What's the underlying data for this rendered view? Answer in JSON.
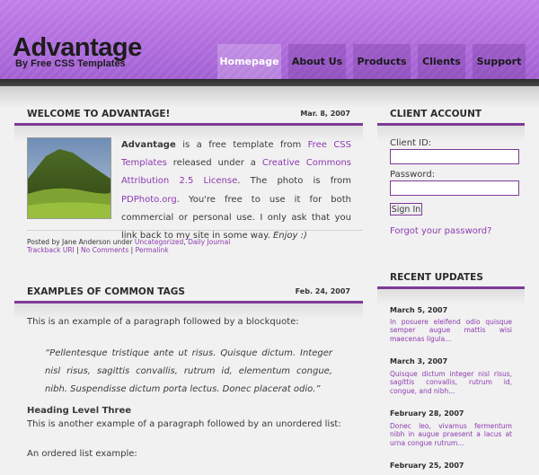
{
  "header": {
    "site_title": "Advantage",
    "site_subtitle": "By Free CSS Templates",
    "nav": [
      {
        "label": "Homepage"
      },
      {
        "label": "About Us"
      },
      {
        "label": "Products"
      },
      {
        "label": "Clients"
      },
      {
        "label": "Support"
      }
    ],
    "active_nav": "Homepage"
  },
  "colors": {
    "header_purple": "#b276de",
    "accent": "#7e3a98",
    "link": "#8d3ab0"
  },
  "post1": {
    "title": "WELCOME TO ADVANTAGE!",
    "date": "Mar. 8, 2007",
    "image_icon": "mountain-landscape-photo",
    "body": {
      "strong": "Advantage",
      "t1": " is a free template from ",
      "link1": "Free CSS Templates",
      "t2": " released under a ",
      "link2": "Creative Commons Attribution 2.5 License",
      "t3": ". The photo is from ",
      "link3": "PDPhoto.org",
      "t4": ". You're free to use it for both commercial or personal use. I only ask that you link back to my site in some way. ",
      "em": "Enjoy :)"
    },
    "meta": {
      "posted_by": "Posted by Jane Anderson under ",
      "cat1": "Uncategorized",
      "sep1": ", ",
      "cat2": "Daily Journal",
      "trackback": "Trackback URI",
      "sep2": " | ",
      "comments": "No Comments",
      "sep3": " | ",
      "permalink": "Permalink"
    }
  },
  "post2": {
    "title": "EXAMPLES OF COMMON TAGS",
    "date": "Feb. 24, 2007",
    "intro": "This is an example of a paragraph followed by a blockquote:",
    "quote": "“Pellentesque tristique ante ut risus. Quisque dictum. Integer nisl risus, sagittis convallis, rutrum id, elementum congue, nibh. Suspendisse dictum porta lectus. Donec placerat odio.”",
    "heading": "Heading Level Three",
    "para2": "This is another example of a paragraph followed by an unordered list:",
    "ordered_label": "An ordered list example:"
  },
  "sidebar": {
    "account_title": "CLIENT ACCOUNT",
    "client_id_label": "Client ID:",
    "client_id_value": "",
    "password_label": "Password:",
    "password_value": "",
    "signin_label": "Sign In",
    "forgot_label": "Forgot your password?",
    "updates_title": "RECENT UPDATES",
    "updates": [
      {
        "date": "March 5, 2007",
        "text": "In posuere eleifend odio quisque semper augue mattis wisi maecenas ligula..."
      },
      {
        "date": "March 3, 2007",
        "text": "Quisque dictum integer nisl risus, sagittis convallis, rutrum id, congue, and nibh..."
      },
      {
        "date": "February 28, 2007",
        "text": "Donec leo, vivamus fermentum nibh in augue praesent a lacus at urna congue rutrum..."
      },
      {
        "date": "February 25, 2007",
        "text": ""
      }
    ]
  }
}
